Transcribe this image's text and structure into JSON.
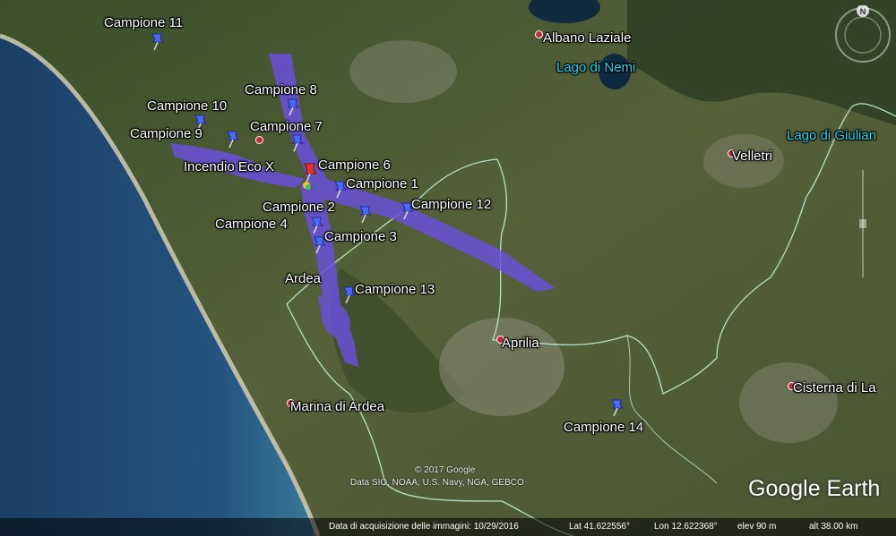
{
  "pins": [
    {
      "label": "Campione 11"
    },
    {
      "label": "Campione 8"
    },
    {
      "label": "Campione 10"
    },
    {
      "label": "Campione 7"
    },
    {
      "label": "Campione 9"
    },
    {
      "label": "Campione 6"
    },
    {
      "label": "Campione 1"
    },
    {
      "label": "Campione 12"
    },
    {
      "label": "Campione 2"
    },
    {
      "label": "Campione 4"
    },
    {
      "label": "Campione 3"
    },
    {
      "label": "Campione 13"
    },
    {
      "label": "Campione 14"
    }
  ],
  "fire": {
    "label": "Incendio Eco X"
  },
  "places": [
    {
      "label": "Albano Laziale"
    },
    {
      "label": "Velletri"
    },
    {
      "label": "Ardea"
    },
    {
      "label": "Aprilia"
    },
    {
      "label": "Marina di Ardea"
    },
    {
      "label": "Cisterna di La"
    }
  ],
  "water": [
    {
      "label": "Lago di Nemi"
    },
    {
      "label": "Lago di Giulian"
    }
  ],
  "compass": {
    "north": "N"
  },
  "credits": {
    "copyright": "© 2017 Google",
    "sources": "Data SIO, NOAA, U.S. Navy, NGA, GEBCO"
  },
  "brand": {
    "logo": "Google Earth"
  },
  "status": {
    "acquisition": "Data di acquisizione delle immagini: 10/29/2016",
    "lat": "Lat   41.622556°",
    "lon": "Lon   12.622368°",
    "elev": "elev    90 m",
    "alt": "alt  38.00 km"
  },
  "colors": {
    "sea": "#1d4a72",
    "land": "#4d5a34",
    "plume": "#6b4fe0",
    "pin": "#4a69ff",
    "fire_pin": "#e8302a",
    "boundary": "#bff2d8",
    "water_label": "#21d7f0"
  }
}
